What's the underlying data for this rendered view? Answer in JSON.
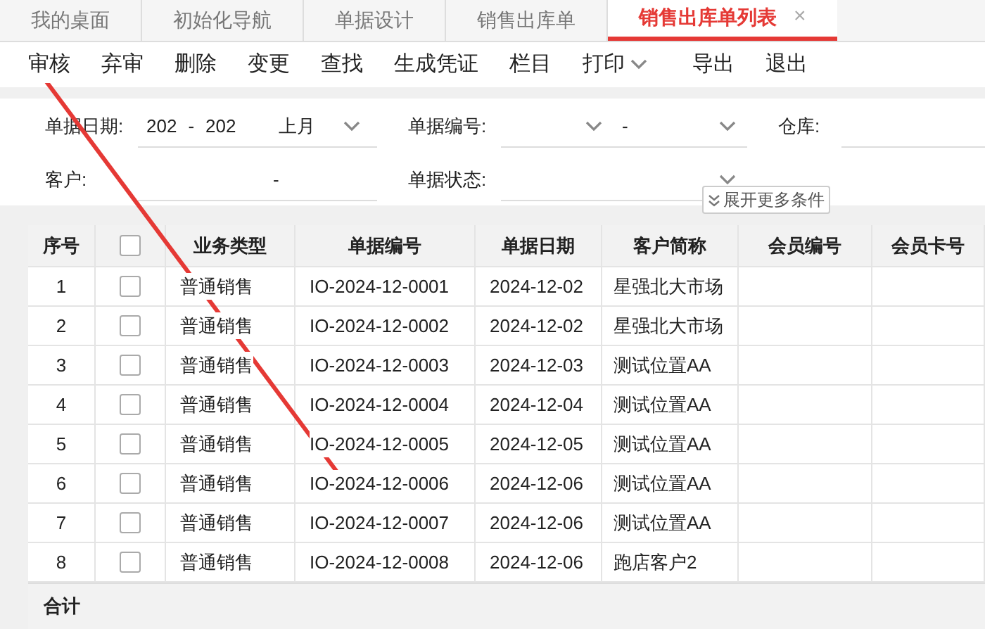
{
  "tabs": [
    {
      "label": "我的桌面",
      "selected": false,
      "closable": false
    },
    {
      "label": "初始化导航",
      "selected": false,
      "closable": false
    },
    {
      "label": "单据设计",
      "selected": false,
      "closable": false
    },
    {
      "label": "销售出库单",
      "selected": false,
      "closable": false
    },
    {
      "label": "销售出库单列表",
      "selected": true,
      "closable": true,
      "close": "×"
    }
  ],
  "toolbar": [
    {
      "label": "审核",
      "dropdown": false
    },
    {
      "label": "弃审",
      "dropdown": false
    },
    {
      "label": "删除",
      "dropdown": false
    },
    {
      "label": "变更",
      "dropdown": false
    },
    {
      "label": "查找",
      "dropdown": false
    },
    {
      "label": "生成凭证",
      "dropdown": false
    },
    {
      "label": "栏目",
      "dropdown": false
    },
    {
      "label": "打印",
      "dropdown": true
    },
    {
      "label": "导出",
      "dropdown": false
    },
    {
      "label": "退出",
      "dropdown": false
    }
  ],
  "filters": {
    "date_label": "单据日期:",
    "date_from": "202",
    "date_sep": "-",
    "date_to": "202",
    "period": "上月",
    "number_label": "单据编号:",
    "number_sep": "-",
    "warehouse_label": "仓库:",
    "customer_label": "客户:",
    "customer_sep": "-",
    "status_label": "单据状态:",
    "expand": "展开更多条件"
  },
  "table": {
    "header_checked": false,
    "columns": [
      "序号",
      "业务类型",
      "单据编号",
      "单据日期",
      "客户简称",
      "会员编号",
      "会员卡号"
    ],
    "rows": [
      {
        "no": "1",
        "checked": false,
        "type": "普通销售",
        "code": "IO-2024-12-0001",
        "date": "2024-12-02",
        "customer": "星强北大市场"
      },
      {
        "no": "2",
        "checked": false,
        "type": "普通销售",
        "code": "IO-2024-12-0002",
        "date": "2024-12-02",
        "customer": "星强北大市场"
      },
      {
        "no": "3",
        "checked": false,
        "type": "普通销售",
        "code": "IO-2024-12-0003",
        "date": "2024-12-03",
        "customer": "测试位置AA"
      },
      {
        "no": "4",
        "checked": false,
        "type": "普通销售",
        "code": "IO-2024-12-0004",
        "date": "2024-12-04",
        "customer": "测试位置AA"
      },
      {
        "no": "5",
        "checked": false,
        "type": "普通销售",
        "code": "IO-2024-12-0005",
        "date": "2024-12-05",
        "customer": "测试位置AA"
      },
      {
        "no": "6",
        "checked": false,
        "type": "普通销售",
        "code": "IO-2024-12-0006",
        "date": "2024-12-06",
        "customer": "测试位置AA"
      },
      {
        "no": "7",
        "checked": false,
        "type": "普通销售",
        "code": "IO-2024-12-0007",
        "date": "2024-12-06",
        "customer": "测试位置AA"
      },
      {
        "no": "8",
        "checked": false,
        "type": "普通销售",
        "code": "IO-2024-12-0008",
        "date": "2024-12-06",
        "customer": "跑店客户2"
      }
    ],
    "total_label": "合计"
  }
}
